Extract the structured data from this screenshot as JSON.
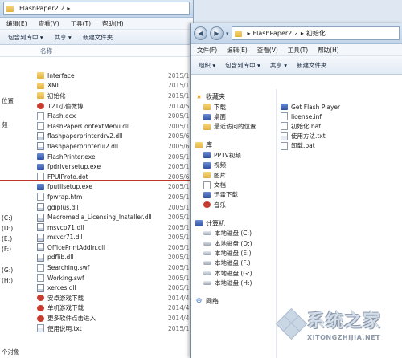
{
  "back": {
    "path": "FlashPaper2.2",
    "menu": [
      "编辑(E)",
      "查看(V)",
      "工具(T)",
      "帮助(H)"
    ],
    "toolbar": [
      "包含到库中",
      "共享",
      "新建文件夹"
    ],
    "column_name": "名称",
    "left_fragments": [
      "位置",
      "频",
      "(C:)",
      "(D:)",
      "(E:)",
      "(F:)",
      "(G:)",
      "(H:)"
    ],
    "status": "个对象",
    "files": [
      {
        "icon": "folder",
        "name": "Interface",
        "date": "2015/1"
      },
      {
        "icon": "folder",
        "name": "XML",
        "date": "2015/1"
      },
      {
        "icon": "folder",
        "name": "初始化",
        "date": "2015/1"
      },
      {
        "icon": "red",
        "name": "121小偷微博",
        "date": "2014/5"
      },
      {
        "icon": "file",
        "name": "Flash.ocx",
        "date": "2005/1"
      },
      {
        "icon": "file",
        "name": "FlashPaperContextMenu.dll",
        "date": "2005/1"
      },
      {
        "icon": "dll",
        "name": "flashpaperprinterdrv2.dll",
        "date": "2005/6"
      },
      {
        "icon": "dll",
        "name": "flashpaperprinterui2.dll",
        "date": "2005/6"
      },
      {
        "icon": "exe",
        "name": "FlashPrinter.exe",
        "date": "2005/1"
      },
      {
        "icon": "exe",
        "name": "fpdriversetup.exe",
        "date": "2005/1"
      },
      {
        "icon": "file",
        "name": "FPUIProto.dot",
        "date": "2005/6"
      },
      {
        "icon": "exe",
        "name": "fputilsetup.exe",
        "date": "2005/1"
      },
      {
        "icon": "file",
        "name": "fpwrap.htm",
        "date": "2005/1"
      },
      {
        "icon": "dll",
        "name": "gdiplus.dll",
        "date": "2005/1"
      },
      {
        "icon": "dll",
        "name": "Macromedia_Licensing_Installer.dll",
        "date": "2005/1"
      },
      {
        "icon": "dll",
        "name": "msvcp71.dll",
        "date": "2005/1"
      },
      {
        "icon": "dll",
        "name": "msvcr71.dll",
        "date": "2005/1"
      },
      {
        "icon": "dll",
        "name": "OfficePrintAddIn.dll",
        "date": "2005/1"
      },
      {
        "icon": "dll",
        "name": "pdflib.dll",
        "date": "2005/1"
      },
      {
        "icon": "file",
        "name": "Searching.swf",
        "date": "2005/1"
      },
      {
        "icon": "file",
        "name": "Working.swf",
        "date": "2005/1"
      },
      {
        "icon": "dll",
        "name": "xerces.dll",
        "date": "2005/1"
      },
      {
        "icon": "red",
        "name": "安卓游戏下载",
        "date": "2014/4"
      },
      {
        "icon": "red",
        "name": "单机游戏下载",
        "date": "2014/4"
      },
      {
        "icon": "red",
        "name": "更多软件点击进入",
        "date": "2014/4"
      },
      {
        "icon": "txt",
        "name": "使用说明.txt",
        "date": "2015/1"
      }
    ]
  },
  "front": {
    "path": [
      "FlashPaper2.2",
      "初始化"
    ],
    "menu": [
      "文件(F)",
      "编辑(E)",
      "查看(V)",
      "工具(T)",
      "帮助(H)"
    ],
    "toolbar": [
      "组织",
      "包含到库中",
      "共享",
      "新建文件夹"
    ],
    "nav": {
      "favorites": {
        "title": "收藏夹",
        "items": [
          "下载",
          "桌面",
          "最近访问的位置"
        ]
      },
      "library": {
        "title": "库",
        "items": [
          "PPTV视频",
          "视频",
          "图片",
          "文档",
          "迅雷下载",
          "音乐"
        ]
      },
      "computer": {
        "title": "计算机",
        "items": [
          "本地磁盘 (C:)",
          "本地磁盘 (D:)",
          "本地磁盘 (E:)",
          "本地磁盘 (F:)",
          "本地磁盘 (G:)",
          "本地磁盘 (H:)"
        ]
      },
      "network": {
        "title": "网络"
      }
    },
    "files": [
      {
        "icon": "exe",
        "name": "Get Flash Player"
      },
      {
        "icon": "file",
        "name": "license.inf"
      },
      {
        "icon": "file",
        "name": "初始化.bat"
      },
      {
        "icon": "txt",
        "name": "使用方法.txt"
      },
      {
        "icon": "file",
        "name": "卸载.bat"
      }
    ]
  },
  "watermark": {
    "title": "系统之家",
    "url": "XITONGZHIJIA.NET"
  }
}
